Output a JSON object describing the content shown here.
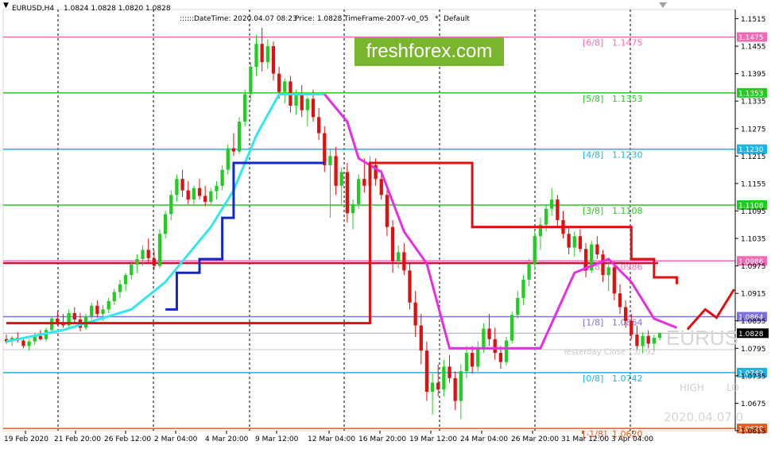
{
  "header": {
    "symbol": "EURUSD,H4",
    "ohlc": "1.0824 1.0828 1.0820 1.0828",
    "datetime": "DateTime: 2020.04.07 08:23",
    "price": "Price: 1.0828",
    "timeframe": "TimeFrame-2007-v0_05",
    "preset": "Default",
    "marker": "::::::",
    "star": "*"
  },
  "brand": {
    "text": "freshforex.com",
    "color": "#7ab52e"
  },
  "watermark": {
    "symbol": "EURUS",
    "date": "2020.04.07 0",
    "high": "HIGH",
    "low": "LO"
  },
  "yesterday_close": "Yesterday Close 1.0792",
  "price_axis": {
    "ticks": [
      "1.1515",
      "1.1455",
      "1.1395",
      "1.1335",
      "1.1275",
      "1.1215",
      "1.1155",
      "1.1095",
      "1.1035",
      "1.0975",
      "1.0915",
      "1.0855",
      "1.0795",
      "1.0735",
      "1.0675",
      "1.0615"
    ],
    "current": {
      "value": "1.0828",
      "color": "#000000"
    }
  },
  "murrey_levels": [
    {
      "label": "[6/8]",
      "value": "1.1475",
      "color": "#f06ab4"
    },
    {
      "label": "[5/8]",
      "value": "1.1353",
      "color": "#22cc22"
    },
    {
      "label": "[4/8]",
      "value": "1.1230",
      "color": "#1eb3e6"
    },
    {
      "label": "[3/8]",
      "value": "1.1108",
      "color": "#22cc22"
    },
    {
      "label": "[2/8]",
      "value": "1.0986",
      "color": "#f06ab4"
    },
    {
      "label": "[1/8]",
      "value": "1.0864",
      "color": "#7c6fe0"
    },
    {
      "label": "[0/8]",
      "value": "1.0742",
      "color": "#1eb3e6"
    },
    {
      "label": "[-1/8]",
      "value": "1.0620",
      "color": "#e65c1e"
    }
  ],
  "time_axis": [
    "19 Feb 2020",
    "21 Feb 20:00",
    "26 Feb 12:00",
    "2 Mar 04:00",
    "4 Mar 20:00",
    "9 Mar 12:00",
    "12 Mar 04:00",
    "16 Mar 20:00",
    "19 Mar 12:00",
    "24 Mar 04:00",
    "26 Mar 20:00",
    "31 Mar 12:00",
    "3 Apr 04:00"
  ],
  "colors": {
    "bull": "#22cc22",
    "bear": "#dd1111",
    "cyan": "#33e6f0",
    "blue": "#1428c8",
    "magenta": "#e62ee6",
    "red": "#e01010",
    "crimson": "#c8143c"
  },
  "chart_data": {
    "type": "candlestick",
    "symbol": "EURUSD",
    "timeframe": "H4",
    "ylim": [
      1.0615,
      1.1535
    ],
    "candles": [
      {
        "o": 1.0815,
        "h": 1.0825,
        "l": 1.0805,
        "c": 1.081
      },
      {
        "o": 1.081,
        "h": 1.0822,
        "l": 1.08,
        "c": 1.0818
      },
      {
        "o": 1.0818,
        "h": 1.083,
        "l": 1.0808,
        "c": 1.0812
      },
      {
        "o": 1.0812,
        "h": 1.0818,
        "l": 1.0795,
        "c": 1.08
      },
      {
        "o": 1.08,
        "h": 1.0815,
        "l": 1.079,
        "c": 1.081
      },
      {
        "o": 1.081,
        "h": 1.0828,
        "l": 1.0802,
        "c": 1.0822
      },
      {
        "o": 1.0822,
        "h": 1.0835,
        "l": 1.0812,
        "c": 1.0815
      },
      {
        "o": 1.0815,
        "h": 1.084,
        "l": 1.081,
        "c": 1.0835
      },
      {
        "o": 1.0835,
        "h": 1.0865,
        "l": 1.083,
        "c": 1.086
      },
      {
        "o": 1.086,
        "h": 1.0875,
        "l": 1.0845,
        "c": 1.0852
      },
      {
        "o": 1.0852,
        "h": 1.087,
        "l": 1.084,
        "c": 1.0845
      },
      {
        "o": 1.0845,
        "h": 1.088,
        "l": 1.0838,
        "c": 1.0872
      },
      {
        "o": 1.0872,
        "h": 1.0885,
        "l": 1.085,
        "c": 1.0858
      },
      {
        "o": 1.0858,
        "h": 1.0872,
        "l": 1.0832,
        "c": 1.084
      },
      {
        "o": 1.084,
        "h": 1.087,
        "l": 1.0835,
        "c": 1.0865
      },
      {
        "o": 1.0865,
        "h": 1.0895,
        "l": 1.0858,
        "c": 1.0888
      },
      {
        "o": 1.0888,
        "h": 1.09,
        "l": 1.0862,
        "c": 1.087
      },
      {
        "o": 1.087,
        "h": 1.089,
        "l": 1.0855,
        "c": 1.088
      },
      {
        "o": 1.088,
        "h": 1.0905,
        "l": 1.0872,
        "c": 1.0898
      },
      {
        "o": 1.0898,
        "h": 1.0925,
        "l": 1.089,
        "c": 1.0918
      },
      {
        "o": 1.0918,
        "h": 1.0945,
        "l": 1.0905,
        "c": 1.0935
      },
      {
        "o": 1.0935,
        "h": 1.096,
        "l": 1.092,
        "c": 1.0955
      },
      {
        "o": 1.0955,
        "h": 1.0985,
        "l": 1.0945,
        "c": 1.0978
      },
      {
        "o": 1.0978,
        "h": 1.1,
        "l": 1.096,
        "c": 1.099
      },
      {
        "o": 1.099,
        "h": 1.102,
        "l": 1.0975,
        "c": 1.101
      },
      {
        "o": 1.101,
        "h": 1.1035,
        "l": 1.098,
        "c": 1.0992
      },
      {
        "o": 1.0992,
        "h": 1.101,
        "l": 1.0965,
        "c": 1.0975
      },
      {
        "o": 1.0975,
        "h": 1.1055,
        "l": 1.097,
        "c": 1.1045
      },
      {
        "o": 1.1045,
        "h": 1.1095,
        "l": 1.1035,
        "c": 1.1088
      },
      {
        "o": 1.1088,
        "h": 1.114,
        "l": 1.1075,
        "c": 1.113
      },
      {
        "o": 1.113,
        "h": 1.1175,
        "l": 1.1115,
        "c": 1.1165
      },
      {
        "o": 1.1165,
        "h": 1.1185,
        "l": 1.1125,
        "c": 1.114
      },
      {
        "o": 1.114,
        "h": 1.116,
        "l": 1.111,
        "c": 1.112
      },
      {
        "o": 1.112,
        "h": 1.115,
        "l": 1.111,
        "c": 1.1145
      },
      {
        "o": 1.1145,
        "h": 1.1165,
        "l": 1.112,
        "c": 1.1128
      },
      {
        "o": 1.1128,
        "h": 1.115,
        "l": 1.1105,
        "c": 1.1115
      },
      {
        "o": 1.1115,
        "h": 1.1145,
        "l": 1.111,
        "c": 1.1138
      },
      {
        "o": 1.1138,
        "h": 1.116,
        "l": 1.112,
        "c": 1.115
      },
      {
        "o": 1.115,
        "h": 1.1195,
        "l": 1.114,
        "c": 1.1185
      },
      {
        "o": 1.1185,
        "h": 1.124,
        "l": 1.1175,
        "c": 1.1232
      },
      {
        "o": 1.1232,
        "h": 1.1265,
        "l": 1.1215,
        "c": 1.1225
      },
      {
        "o": 1.1225,
        "h": 1.13,
        "l": 1.122,
        "c": 1.129
      },
      {
        "o": 1.129,
        "h": 1.136,
        "l": 1.128,
        "c": 1.135
      },
      {
        "o": 1.135,
        "h": 1.142,
        "l": 1.1335,
        "c": 1.141
      },
      {
        "o": 1.141,
        "h": 1.148,
        "l": 1.139,
        "c": 1.146
      },
      {
        "o": 1.146,
        "h": 1.1495,
        "l": 1.14,
        "c": 1.142
      },
      {
        "o": 1.142,
        "h": 1.147,
        "l": 1.1405,
        "c": 1.1455
      },
      {
        "o": 1.1455,
        "h": 1.1465,
        "l": 1.138,
        "c": 1.1395
      },
      {
        "o": 1.1395,
        "h": 1.141,
        "l": 1.134,
        "c": 1.1355
      },
      {
        "o": 1.1355,
        "h": 1.1385,
        "l": 1.133,
        "c": 1.1378
      },
      {
        "o": 1.1378,
        "h": 1.139,
        "l": 1.131,
        "c": 1.1325
      },
      {
        "o": 1.1325,
        "h": 1.136,
        "l": 1.1305,
        "c": 1.135
      },
      {
        "o": 1.135,
        "h": 1.137,
        "l": 1.13,
        "c": 1.1315
      },
      {
        "o": 1.1315,
        "h": 1.1345,
        "l": 1.128,
        "c": 1.134
      },
      {
        "o": 1.134,
        "h": 1.136,
        "l": 1.129,
        "c": 1.13
      },
      {
        "o": 1.13,
        "h": 1.132,
        "l": 1.125,
        "c": 1.1265
      },
      {
        "o": 1.1265,
        "h": 1.128,
        "l": 1.118,
        "c": 1.1195
      },
      {
        "o": 1.1195,
        "h": 1.123,
        "l": 1.108,
        "c": 1.1215
      },
      {
        "o": 1.1215,
        "h": 1.1235,
        "l": 1.113,
        "c": 1.115
      },
      {
        "o": 1.115,
        "h": 1.119,
        "l": 1.111,
        "c": 1.118
      },
      {
        "o": 1.118,
        "h": 1.12,
        "l": 1.107,
        "c": 1.109
      },
      {
        "o": 1.109,
        "h": 1.112,
        "l": 1.1055,
        "c": 1.111
      },
      {
        "o": 1.111,
        "h": 1.1175,
        "l": 1.11,
        "c": 1.1165
      },
      {
        "o": 1.1165,
        "h": 1.121,
        "l": 1.1135,
        "c": 1.115
      },
      {
        "o": 1.115,
        "h": 1.1215,
        "l": 1.114,
        "c": 1.1195
      },
      {
        "o": 1.1195,
        "h": 1.121,
        "l": 1.115,
        "c": 1.1165
      },
      {
        "o": 1.1165,
        "h": 1.1185,
        "l": 1.112,
        "c": 1.113
      },
      {
        "o": 1.113,
        "h": 1.114,
        "l": 1.104,
        "c": 1.106
      },
      {
        "o": 1.106,
        "h": 1.1075,
        "l": 1.096,
        "c": 1.0985
      },
      {
        "o": 1.0985,
        "h": 1.102,
        "l": 1.097,
        "c": 1.1005
      },
      {
        "o": 1.1005,
        "h": 1.1025,
        "l": 1.0955,
        "c": 1.0965
      },
      {
        "o": 1.0965,
        "h": 1.098,
        "l": 1.088,
        "c": 1.0895
      },
      {
        "o": 1.0895,
        "h": 1.092,
        "l": 1.082,
        "c": 1.0845
      },
      {
        "o": 1.0845,
        "h": 1.087,
        "l": 1.076,
        "c": 1.079
      },
      {
        "o": 1.079,
        "h": 1.081,
        "l": 1.068,
        "c": 1.07
      },
      {
        "o": 1.07,
        "h": 1.074,
        "l": 1.065,
        "c": 1.072
      },
      {
        "o": 1.072,
        "h": 1.076,
        "l": 1.069,
        "c": 1.0705
      },
      {
        "o": 1.0705,
        "h": 1.077,
        "l": 1.069,
        "c": 1.0755
      },
      {
        "o": 1.0755,
        "h": 1.078,
        "l": 1.072,
        "c": 1.073
      },
      {
        "o": 1.073,
        "h": 1.0745,
        "l": 1.066,
        "c": 1.068
      },
      {
        "o": 1.068,
        "h": 1.076,
        "l": 1.064,
        "c": 1.0745
      },
      {
        "o": 1.0745,
        "h": 1.08,
        "l": 1.073,
        "c": 1.0785
      },
      {
        "o": 1.0785,
        "h": 1.08,
        "l": 1.074,
        "c": 1.0755
      },
      {
        "o": 1.0755,
        "h": 1.081,
        "l": 1.0745,
        "c": 1.0795
      },
      {
        "o": 1.0795,
        "h": 1.085,
        "l": 1.0785,
        "c": 1.0838
      },
      {
        "o": 1.0838,
        "h": 1.087,
        "l": 1.08,
        "c": 1.0815
      },
      {
        "o": 1.0815,
        "h": 1.084,
        "l": 1.077,
        "c": 1.0785
      },
      {
        "o": 1.0785,
        "h": 1.08,
        "l": 1.075,
        "c": 1.0765
      },
      {
        "o": 1.0765,
        "h": 1.082,
        "l": 1.0758,
        "c": 1.0812
      },
      {
        "o": 1.0812,
        "h": 1.0875,
        "l": 1.0805,
        "c": 1.0868
      },
      {
        "o": 1.0868,
        "h": 1.092,
        "l": 1.086,
        "c": 1.0905
      },
      {
        "o": 1.0905,
        "h": 1.0955,
        "l": 1.089,
        "c": 1.0945
      },
      {
        "o": 1.0945,
        "h": 1.099,
        "l": 1.093,
        "c": 1.098
      },
      {
        "o": 1.098,
        "h": 1.105,
        "l": 1.0965,
        "c": 1.104
      },
      {
        "o": 1.104,
        "h": 1.108,
        "l": 1.101,
        "c": 1.1065
      },
      {
        "o": 1.1065,
        "h": 1.111,
        "l": 1.105,
        "c": 1.11
      },
      {
        "o": 1.11,
        "h": 1.1145,
        "l": 1.1085,
        "c": 1.112
      },
      {
        "o": 1.112,
        "h": 1.113,
        "l": 1.106,
        "c": 1.1075
      },
      {
        "o": 1.1075,
        "h": 1.1095,
        "l": 1.1035,
        "c": 1.1045
      },
      {
        "o": 1.1045,
        "h": 1.106,
        "l": 1.1,
        "c": 1.1015
      },
      {
        "o": 1.1015,
        "h": 1.105,
        "l": 1.0995,
        "c": 1.104
      },
      {
        "o": 1.104,
        "h": 1.1055,
        "l": 1.1005,
        "c": 1.1012
      },
      {
        "o": 1.1012,
        "h": 1.1025,
        "l": 1.095,
        "c": 1.0965
      },
      {
        "o": 1.0965,
        "h": 1.103,
        "l": 1.096,
        "c": 1.1022
      },
      {
        "o": 1.1022,
        "h": 1.104,
        "l": 1.099,
        "c": 1.1
      },
      {
        "o": 1.1,
        "h": 1.101,
        "l": 1.094,
        "c": 1.0955
      },
      {
        "o": 1.0955,
        "h": 1.0985,
        "l": 1.092,
        "c": 1.0972
      },
      {
        "o": 1.0972,
        "h": 1.0985,
        "l": 1.09,
        "c": 1.0915
      },
      {
        "o": 1.0915,
        "h": 1.0935,
        "l": 1.087,
        "c": 1.0885
      },
      {
        "o": 1.0885,
        "h": 1.09,
        "l": 1.084,
        "c": 1.0855
      },
      {
        "o": 1.0855,
        "h": 1.087,
        "l": 1.0815,
        "c": 1.0825
      },
      {
        "o": 1.0825,
        "h": 1.0845,
        "l": 1.079,
        "c": 1.08
      },
      {
        "o": 1.08,
        "h": 1.083,
        "l": 1.0785,
        "c": 1.0822
      },
      {
        "o": 1.0822,
        "h": 1.0835,
        "l": 1.0795,
        "c": 1.0805
      },
      {
        "o": 1.0805,
        "h": 1.0825,
        "l": 1.079,
        "c": 1.0818
      },
      {
        "o": 1.0818,
        "h": 1.083,
        "l": 1.0812,
        "c": 1.0828
      }
    ],
    "indicators": {
      "cyan_trail": [
        [
          0,
          1.081
        ],
        [
          10,
          1.0835
        ],
        [
          22,
          1.088
        ],
        [
          28,
          1.094
        ],
        [
          32,
          1.1
        ],
        [
          36,
          1.106
        ],
        [
          40,
          1.114
        ],
        [
          44,
          1.126
        ],
        [
          48,
          1.135
        ],
        [
          56,
          1.135
        ]
      ],
      "blue_step": [
        [
          28,
          1.088
        ],
        [
          30,
          1.096
        ],
        [
          34,
          1.099
        ],
        [
          38,
          1.108
        ],
        [
          40,
          1.12
        ],
        [
          56,
          1.12
        ]
      ],
      "magenta_trail": [
        [
          56,
          1.135
        ],
        [
          60,
          1.129
        ],
        [
          62,
          1.121
        ],
        [
          66,
          1.118
        ],
        [
          70,
          1.105
        ],
        [
          74,
          1.098
        ],
        [
          78,
          1.0795
        ],
        [
          94,
          1.0795
        ],
        [
          100,
          1.096
        ],
        [
          106,
          1.099
        ],
        [
          110,
          1.094
        ],
        [
          114,
          1.086
        ],
        [
          118,
          1.084
        ]
      ],
      "red_step": [
        [
          0,
          1.085
        ],
        [
          28,
          1.085
        ],
        [
          64,
          1.12
        ],
        [
          80,
          1.12
        ],
        [
          82,
          1.106
        ],
        [
          108,
          1.106
        ],
        [
          110,
          1.099
        ],
        [
          114,
          1.095
        ],
        [
          118,
          1.0935
        ]
      ],
      "red_forecast": [
        [
          120,
          1.0838
        ],
        [
          123,
          1.088
        ],
        [
          125,
          1.0862
        ],
        [
          128,
          1.0922
        ]
      ]
    }
  }
}
